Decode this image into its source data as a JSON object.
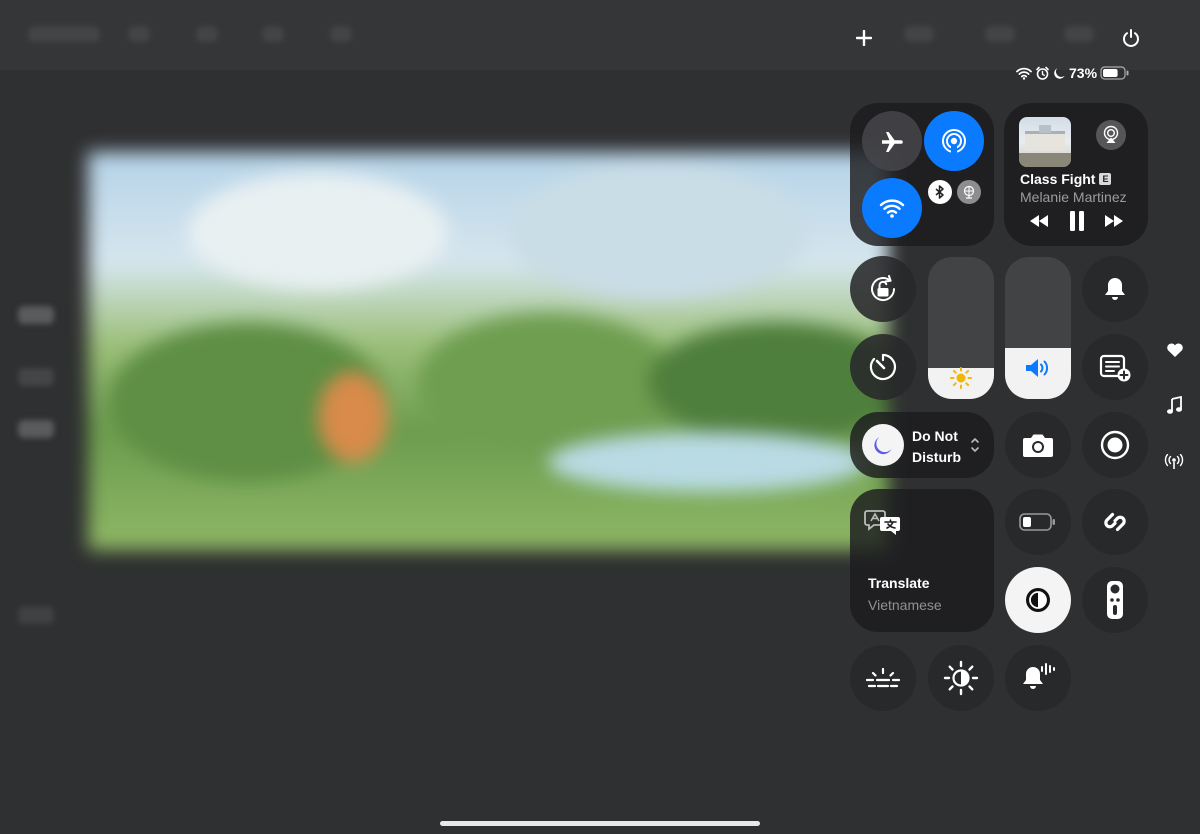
{
  "status_bar": {
    "battery_percent": "73%",
    "battery_level": 0.73
  },
  "top_controls": {
    "add_icon": "plus-icon",
    "power_icon": "power-icon"
  },
  "connectivity": {
    "airplane_mode": false,
    "airdrop": true,
    "wifi": true,
    "bluetooth": true,
    "accent_color": "#0a7aff"
  },
  "now_playing": {
    "title": "Class Fight",
    "explicit_badge": "E",
    "artist": "Melanie Martinez"
  },
  "sliders": {
    "brightness_level": 0.22,
    "volume_level": 0.36
  },
  "focus": {
    "label": "Do Not Disturb"
  },
  "translate": {
    "title": "Translate",
    "language": "Vietnamese"
  },
  "side_indicators": [
    "heart-icon",
    "music-note-icon",
    "antenna-icon"
  ],
  "colors": {
    "module_bg": "#1c1c1e",
    "active_blue": "#0a7aff",
    "white_control": "#f4f4f4"
  }
}
